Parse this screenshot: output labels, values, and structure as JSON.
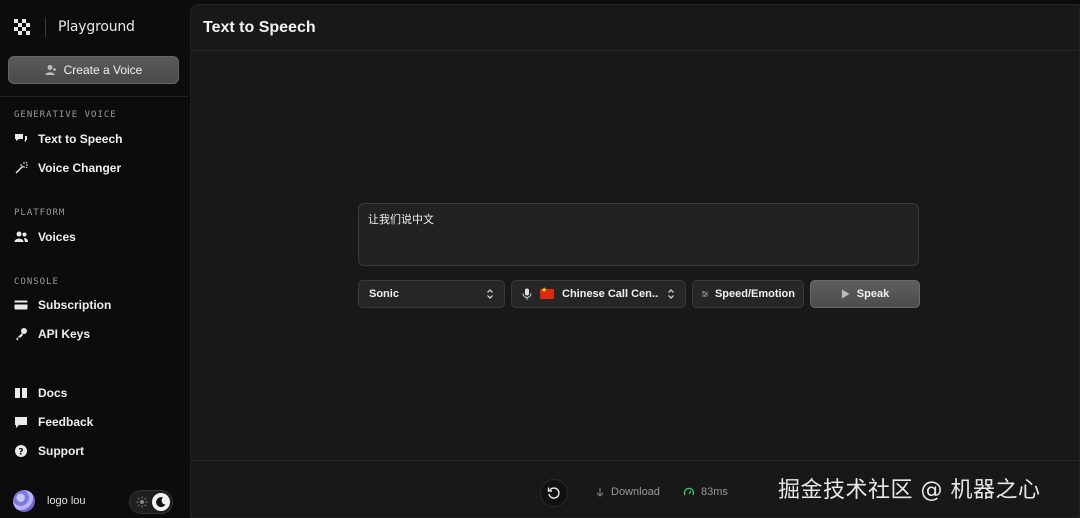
{
  "app": {
    "name": "Playground"
  },
  "sidebar": {
    "create_button": "Create a Voice",
    "sections": [
      {
        "label": "GENERATIVE VOICE",
        "items": [
          {
            "label": "Text to Speech",
            "icon": "speech-bubbles-icon"
          },
          {
            "label": "Voice Changer",
            "icon": "magic-wand-icon"
          }
        ]
      },
      {
        "label": "PLATFORM",
        "items": [
          {
            "label": "Voices",
            "icon": "users-icon"
          }
        ]
      },
      {
        "label": "CONSOLE",
        "items": [
          {
            "label": "Subscription",
            "icon": "credit-card-icon"
          },
          {
            "label": "API Keys",
            "icon": "key-icon"
          }
        ]
      }
    ],
    "bottom_items": [
      {
        "label": "Docs",
        "icon": "book-icon"
      },
      {
        "label": "Feedback",
        "icon": "chat-icon"
      },
      {
        "label": "Support",
        "icon": "help-icon"
      }
    ],
    "user": {
      "name": "logo lou"
    }
  },
  "main": {
    "title": "Text to Speech",
    "input_text": "让我们说中文",
    "model": "Sonic",
    "voice": "Chinese Call Cen...",
    "speed_button": "Speed/Emotion",
    "speak_button": "Speak",
    "footer": {
      "download": "Download",
      "latency": "83ms"
    }
  },
  "watermark": "掘金技术社区 @ 机器之心",
  "colors": {
    "background": "#0c0c0c",
    "panel": "#181818",
    "latency_icon": "#3bbf6b"
  }
}
